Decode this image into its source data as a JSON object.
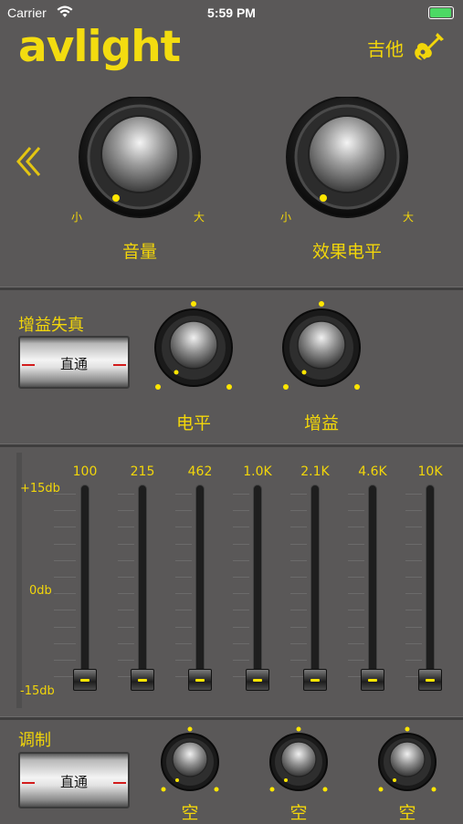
{
  "status_bar": {
    "carrier": "Carrier",
    "time": "5:59 PM"
  },
  "header": {
    "logo": "avlight",
    "mode_label": "吉他",
    "mode_icon": "guitar-icon"
  },
  "nav": {
    "back_icon": "chevron-left-icon"
  },
  "top_knobs": [
    {
      "label": "音量",
      "min_label": "小",
      "max_label": "大"
    },
    {
      "label": "效果电平",
      "min_label": "小",
      "max_label": "大"
    }
  ],
  "distortion": {
    "title": "增益失真",
    "toggle_label": "直通",
    "knobs": [
      {
        "label": "电平"
      },
      {
        "label": "增益"
      }
    ]
  },
  "equalizer": {
    "bands": [
      "100",
      "215",
      "462",
      "1.0K",
      "2.1K",
      "4.6K",
      "10K"
    ],
    "db_labels": {
      "top": "+15db",
      "mid": "0db",
      "bottom": "-15db"
    },
    "gains_db": [
      -15,
      -15,
      -15,
      -15,
      -15,
      -15,
      -15
    ]
  },
  "modulation": {
    "title": "调制",
    "toggle_label": "直通",
    "knobs": [
      {
        "label": "空"
      },
      {
        "label": "空"
      },
      {
        "label": "空"
      }
    ]
  },
  "colors": {
    "accent": "#f2d60a",
    "background": "#5a5858",
    "toggle_mark": "#d31c1c"
  }
}
